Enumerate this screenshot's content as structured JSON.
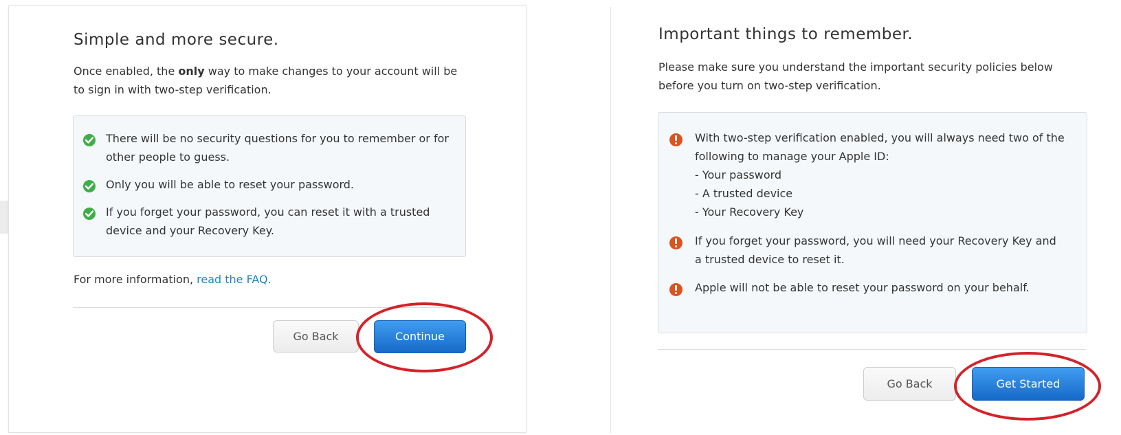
{
  "left": {
    "title": "Simple and more secure.",
    "intro_part1": "Once enabled, the ",
    "intro_bold": "only",
    "intro_part2": " way to make changes to your account will be to sign in with two-step verification.",
    "benefits": [
      {
        "icon": "check-icon",
        "text": "There will be no security questions for you to remember or for other people to guess."
      },
      {
        "icon": "check-icon",
        "text": "Only you will be able to reset your password."
      },
      {
        "icon": "check-icon",
        "text": "If you forget your password, you can reset it with a trusted device and your Recovery Key."
      }
    ],
    "faq_prefix": "For more information, ",
    "faq_link": "read the FAQ.",
    "back_label": "Go Back",
    "continue_label": "Continue"
  },
  "right": {
    "title": "Important things to remember.",
    "intro": "Please make sure you understand the important security policies below before you turn on two-step verification.",
    "policies": [
      {
        "icon": "alert-icon",
        "lines": [
          "With two-step verification enabled, you will always need two of the following to manage your Apple ID:",
          "- Your password",
          "- A trusted device",
          "- Your Recovery Key"
        ]
      },
      {
        "icon": "alert-icon",
        "lines": [
          "If you forget your password, you will need your Recovery Key and a trusted device to reset it."
        ]
      },
      {
        "icon": "alert-icon",
        "lines": [
          "Apple will not be able to reset your password on your behalf."
        ]
      }
    ],
    "back_label": "Go Back",
    "start_label": "Get Started"
  },
  "colors": {
    "accent_blue": "#1a88c9",
    "button_blue": "#2a82dc",
    "check_green": "#3fae49",
    "alert_red": "#d9541e",
    "highlight_ring": "#d2232a"
  }
}
